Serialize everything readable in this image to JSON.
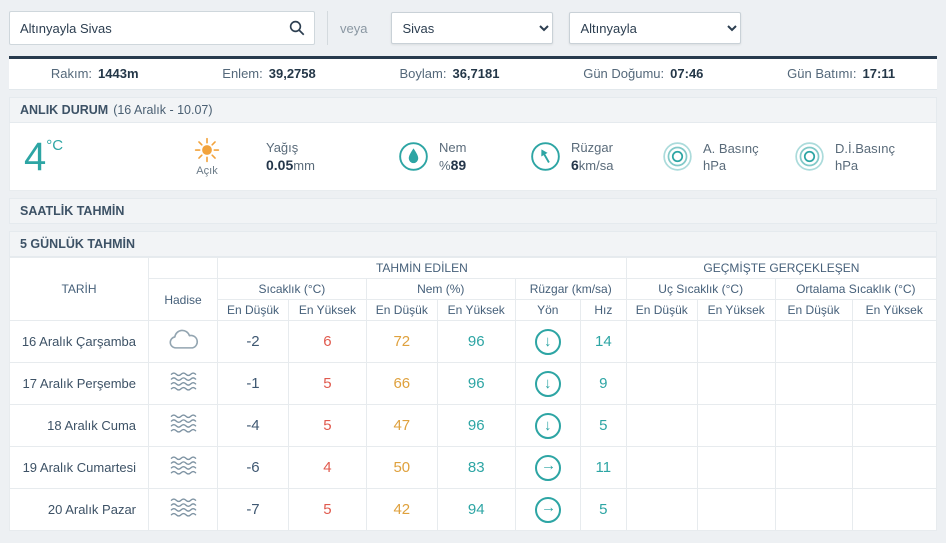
{
  "search": {
    "value": "Altınyayla Sivas",
    "or_label": "veya",
    "province_selected": "Sivas",
    "district_selected": "Altınyayla"
  },
  "stats": [
    {
      "label": "Rakım:",
      "value": "1443m"
    },
    {
      "label": "Enlem:",
      "value": "39,2758"
    },
    {
      "label": "Boylam:",
      "value": "36,7181"
    },
    {
      "label": "Gün Doğumu:",
      "value": "07:46"
    },
    {
      "label": "Gün Batımı:",
      "value": "17:11"
    }
  ],
  "current": {
    "section_title": "ANLIK DURUM",
    "section_subtitle": "(16 Aralık - 10.07)",
    "temperature": "4",
    "temperature_unit": "°C",
    "condition": "Açık",
    "precipitation": {
      "label": "Yağış",
      "value": "0.05",
      "unit": "mm"
    },
    "humidity": {
      "label": "Nem",
      "prefix": "%",
      "value": "89"
    },
    "wind": {
      "label": "Rüzgar",
      "value": "6",
      "unit": "km/sa"
    },
    "pressure": {
      "label": "A. Basınç",
      "unit": "hPa"
    },
    "sea_level_pressure": {
      "label": "D.İ.Basınç",
      "unit": "hPa"
    }
  },
  "hourly": {
    "section_title": "SAATLİK TAHMİN"
  },
  "daily": {
    "section_title": "5 GÜNLÜK TAHMİN",
    "table": {
      "col_date": "TARİH",
      "col_event": "Hadise",
      "group_forecast": "TAHMİN EDİLEN",
      "group_past": "GEÇMİŞTE GERÇEKLEŞEN",
      "sub_temperature": "Sıcaklık (°C)",
      "sub_humidity": "Nem (%)",
      "sub_wind": "Rüzgar (km/sa)",
      "sub_extreme": "Uç Sıcaklık (°C)",
      "sub_average": "Ortalama Sıcaklık (°C)",
      "low_label": "En Düşük",
      "high_label": "En Yüksek",
      "dir_label": "Yön",
      "speed_label": "Hız",
      "rows": [
        {
          "date": "16 Aralık Çarşamba",
          "icon": "cloud",
          "temp_min": "-2",
          "temp_max": "6",
          "hum_min": "72",
          "hum_max": "96",
          "wind_dir": "down",
          "wind_speed": "14",
          "past_ext_min": "",
          "past_ext_max": "",
          "past_avg_min": "",
          "past_avg_max": ""
        },
        {
          "date": "17 Aralık Perşembe",
          "icon": "fog",
          "temp_min": "-1",
          "temp_max": "5",
          "hum_min": "66",
          "hum_max": "96",
          "wind_dir": "down",
          "wind_speed": "9",
          "past_ext_min": "",
          "past_ext_max": "",
          "past_avg_min": "",
          "past_avg_max": ""
        },
        {
          "date": "18 Aralık Cuma",
          "icon": "fog",
          "temp_min": "-4",
          "temp_max": "5",
          "hum_min": "47",
          "hum_max": "96",
          "wind_dir": "down",
          "wind_speed": "5",
          "past_ext_min": "",
          "past_ext_max": "",
          "past_avg_min": "",
          "past_avg_max": ""
        },
        {
          "date": "19 Aralık Cumartesi",
          "icon": "fog",
          "temp_min": "-6",
          "temp_max": "4",
          "hum_min": "50",
          "hum_max": "83",
          "wind_dir": "right",
          "wind_speed": "11",
          "past_ext_min": "",
          "past_ext_max": "",
          "past_avg_min": "",
          "past_avg_max": ""
        },
        {
          "date": "20 Aralık Pazar",
          "icon": "fog",
          "temp_min": "-7",
          "temp_max": "5",
          "hum_min": "42",
          "hum_max": "94",
          "wind_dir": "right",
          "wind_speed": "5",
          "past_ext_min": "",
          "past_ext_max": "",
          "past_avg_min": "",
          "past_avg_max": ""
        }
      ]
    }
  }
}
